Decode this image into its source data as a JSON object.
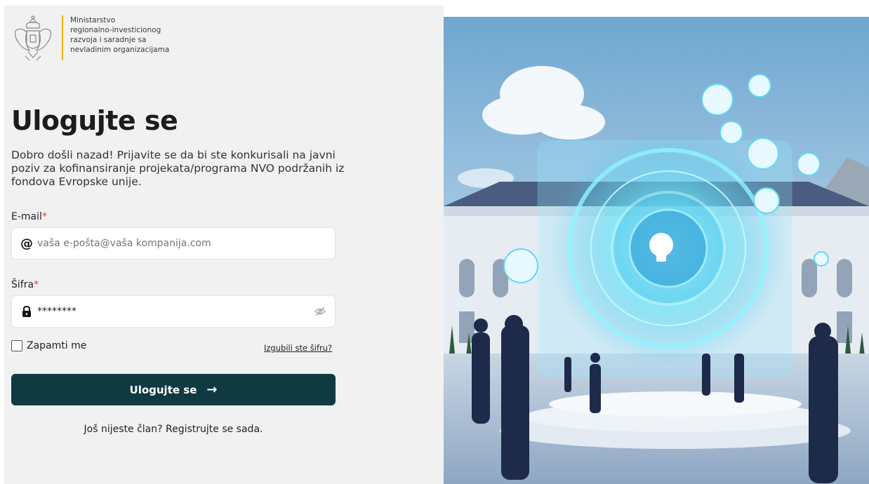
{
  "ministry": {
    "lines": [
      "Ministarstvo",
      "regionalno-investicionog",
      "razvoja i saradnje sa",
      "nevladinim organizacijama"
    ]
  },
  "login": {
    "title": "Ulogujte se",
    "intro": "Dobro došli nazad! Prijavite se da bi ste konkurisali na javni poziv za kofinansiranje projekata/programa NVO podržanih iz fondova Evropske unije.",
    "email_label": "E-mail",
    "email_placeholder": "vaša e-pošta@vaša kompanija.com",
    "password_label": "Šifra",
    "password_value": "********",
    "required_mark": "*",
    "remember_label": "Zapamti me",
    "forgot_link": "Izgubili ste šifru?",
    "submit_label": "Ulogujte se",
    "submit_arrow": "→",
    "register_text": "Još nijeste član? Registrujte se sada."
  },
  "icons": {
    "email_icon": "@",
    "colors": {
      "accent": "#0f3b40",
      "required": "#e53935",
      "divider": "#f0b400"
    }
  }
}
